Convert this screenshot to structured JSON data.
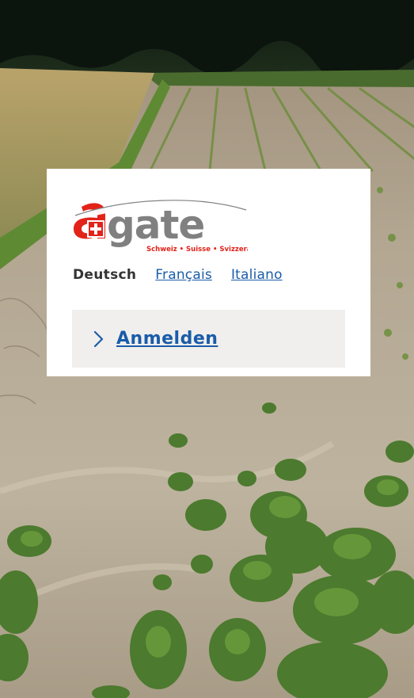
{
  "logo": {
    "wordmark": "agate",
    "tagline": "Schweiz • Suisse • Svizzera",
    "brand_red": "#e2231a",
    "brand_gray": "#808080"
  },
  "languages": {
    "current": "Deutsch",
    "options": [
      "Français",
      "Italiano"
    ]
  },
  "login": {
    "label": "Anmelden",
    "icon": "chevron-right-icon"
  },
  "colors": {
    "link": "#1a5ca8",
    "login_box_bg": "#f0efed",
    "card_bg": "#ffffff"
  }
}
